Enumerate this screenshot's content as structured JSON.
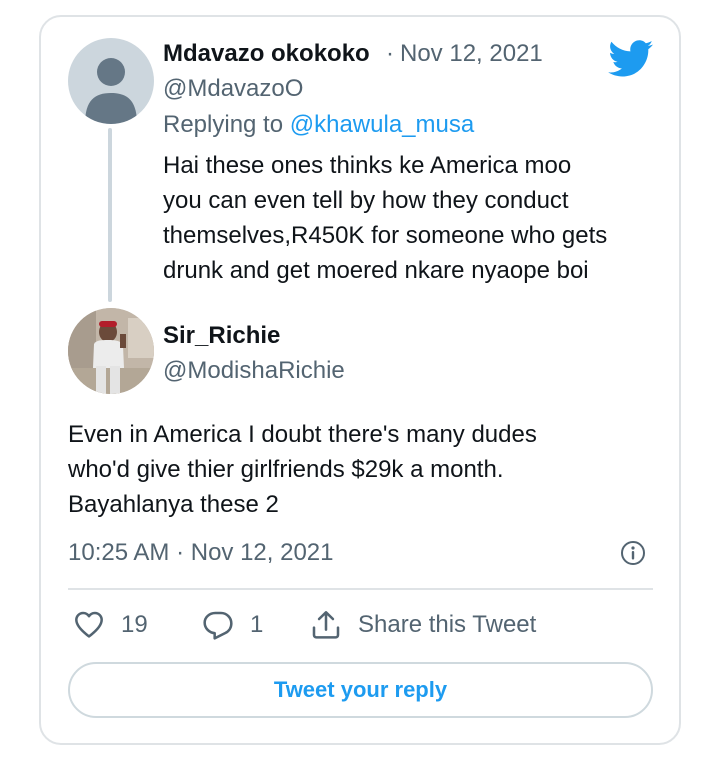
{
  "parent_tweet": {
    "display_name": "Mdavazo okokoko",
    "separator": "·",
    "date": "Nov 12, 2021",
    "handle": "@MdavazoO",
    "replying_prefix": "Replying to ",
    "replying_to": "@khawula_musa",
    "text_lines": [
      "Hai these ones thinks ke America moo",
      "you can even tell by how they conduct",
      "themselves,R450K for someone who gets",
      "drunk and get moered nkare nyaope boi"
    ]
  },
  "main_tweet": {
    "display_name": "Sir_Richie",
    "handle": "@ModishaRichie",
    "text_lines": [
      "Even in America I doubt there's many dudes",
      "who'd give thier girlfriends $29k a month.",
      "Bayahlanya these 2"
    ],
    "timestamp": "10:25 AM · Nov 12, 2021"
  },
  "actions": {
    "like_count": "19",
    "reply_count": "1",
    "share_label": "Share this Tweet"
  },
  "reply_button_label": "Tweet your reply",
  "colors": {
    "brand_blue": "#1d9bf0",
    "muted_text": "#536471",
    "border": "#dfe3e6"
  },
  "icons": [
    "twitter-bird-icon",
    "info-icon",
    "heart-icon",
    "reply-bubble-icon",
    "share-icon"
  ]
}
